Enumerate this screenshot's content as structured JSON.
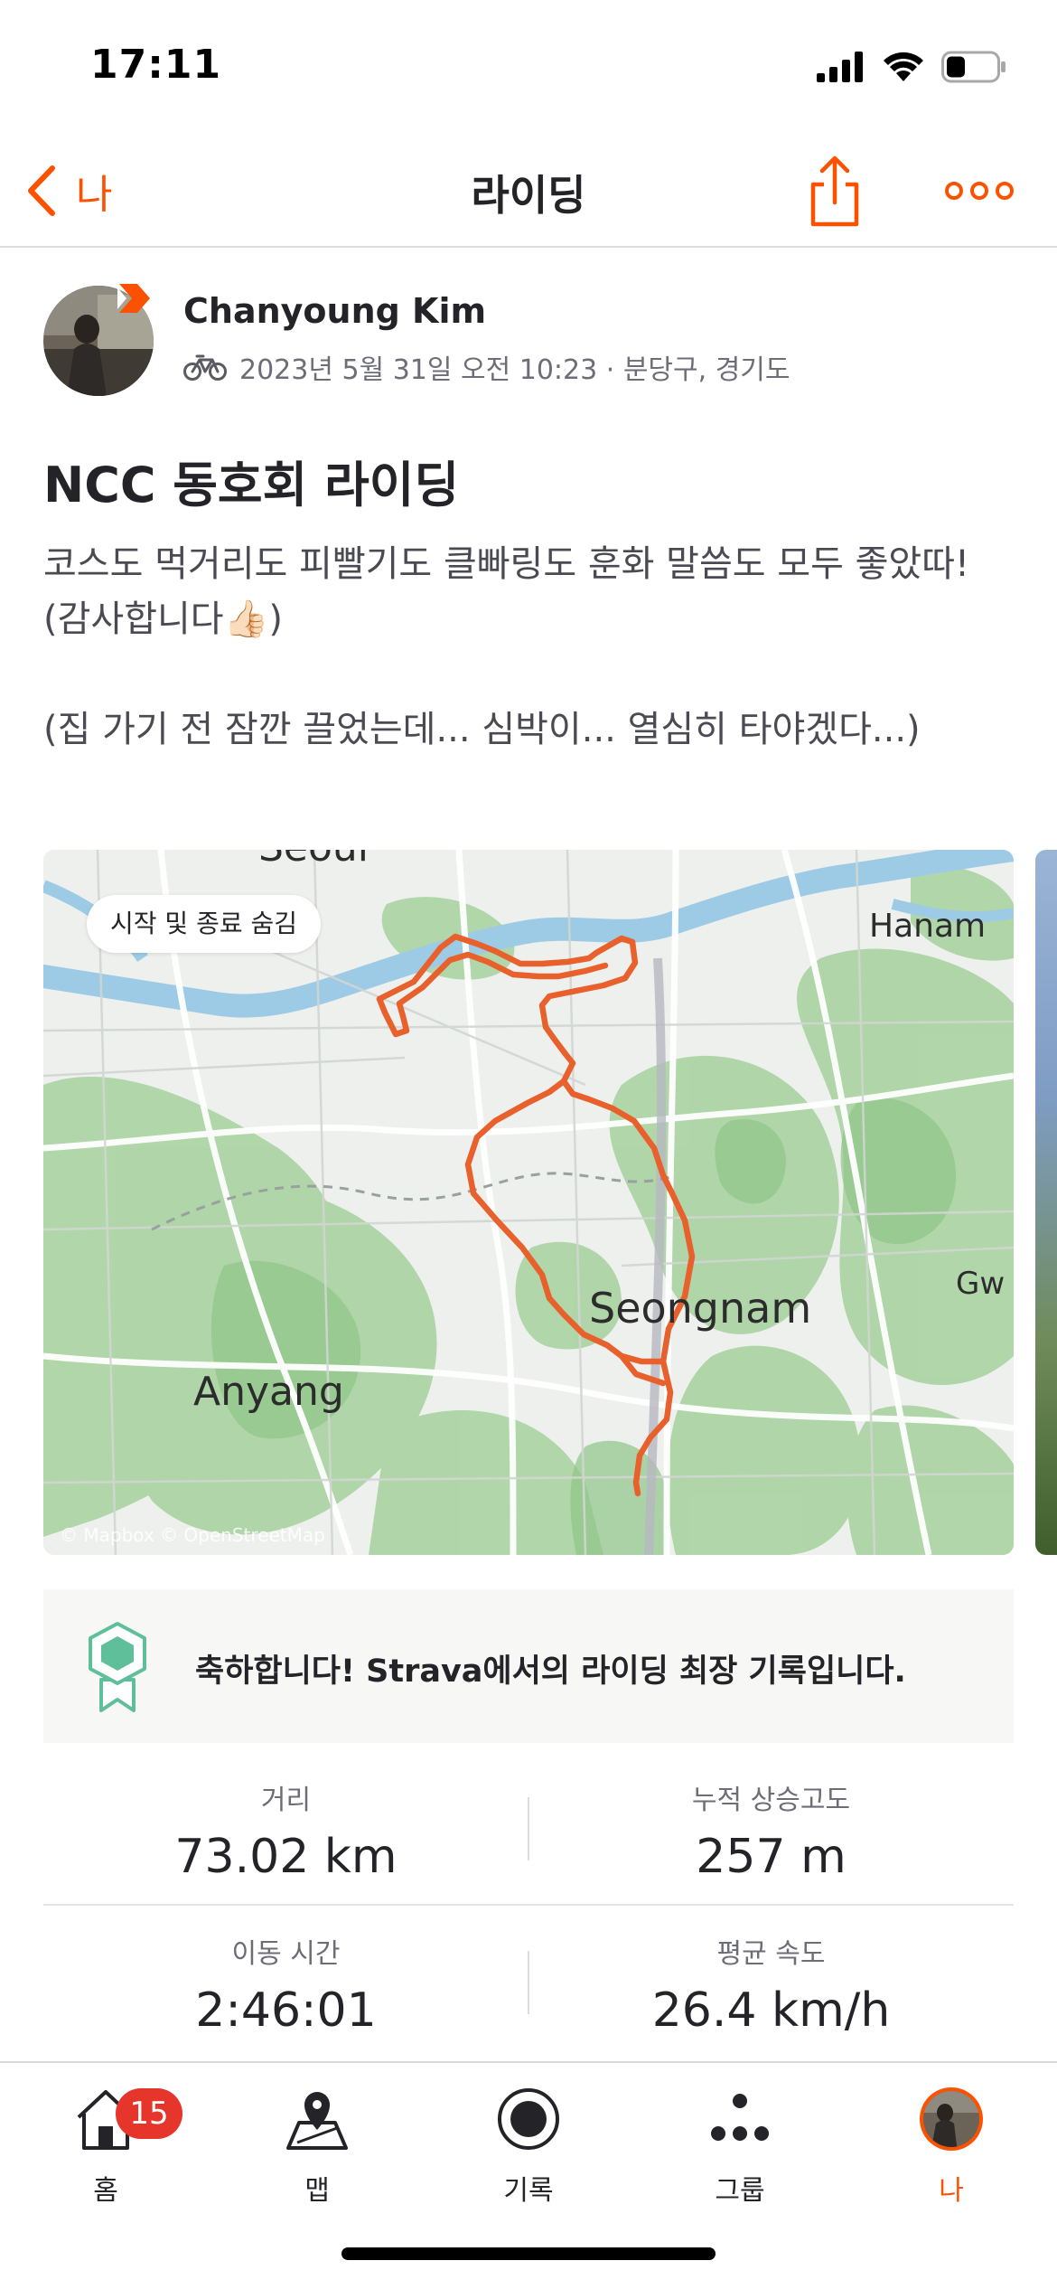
{
  "status_bar": {
    "time": "17:11"
  },
  "nav": {
    "back_label": "나",
    "title": "라이딩"
  },
  "activity": {
    "athlete_name": "Chanyoung Kim",
    "meta": "2023년 5월 31일 오전 10:23 · 분당구, 경기도",
    "sport_icon": "bike-icon",
    "title": "NCC 동호회 라이딩",
    "description": "코스도 먹거리도 피빨기도 클빠링도 훈화 말씀도 모두 좋았따!\n(감사합니다👍🏻)\n\n(집 가기 전 잠깐 끌었는데... 심박이... 열심히 타야겠다...)"
  },
  "map": {
    "pill": "시작 및 종료 숨김",
    "labels": {
      "seoul": "Seoul",
      "hanam": "Hanam",
      "seongnam": "Seongnam",
      "anyang": "Anyang",
      "gw": "Gw"
    },
    "attribution": "© Mapbox © OpenStreetMap",
    "route_color": "#e8602c"
  },
  "achievement": {
    "text": "축하합니다! Strava에서의 라이딩 최장 기록입니다.",
    "icon": "achievement-badge-icon",
    "color": "#5fbf9a"
  },
  "stats": [
    {
      "label": "거리",
      "value": "73.02 km"
    },
    {
      "label": "누적 상승고도",
      "value": "257 m"
    },
    {
      "label": "이동 시간",
      "value": "2:46:01"
    },
    {
      "label": "평균 속도",
      "value": "26.4 km/h"
    }
  ],
  "tabbar": {
    "home": {
      "label": "홈",
      "badge": "15"
    },
    "map": {
      "label": "맵"
    },
    "record": {
      "label": "기록"
    },
    "groups": {
      "label": "그룹"
    },
    "me": {
      "label": "나"
    }
  },
  "colors": {
    "accent": "#fc5200",
    "badge": "#e6352b"
  }
}
